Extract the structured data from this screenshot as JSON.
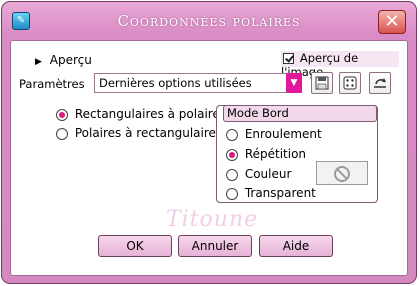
{
  "window": {
    "title": "Coordonnées polaires",
    "app_icon": "paint-app-icon",
    "close_icon": "close-icon",
    "close_glyph": "✕"
  },
  "preview": {
    "apercu_label": "Aperçu",
    "apercu_image_label": "Aperçu de l'image",
    "apercu_image_checked": true
  },
  "presets": {
    "label": "Paramètres",
    "selected": "Dernières options utilisées",
    "buttons": [
      "save-preset-icon",
      "randomize-icon",
      "reset-icon"
    ]
  },
  "conversion": {
    "options": [
      {
        "label": "Rectangulaires à polaires",
        "selected": true
      },
      {
        "label": "Polaires à rectangulaires",
        "selected": false
      }
    ]
  },
  "edge_mode": {
    "title": "Mode Bord",
    "options": [
      {
        "label": "Enroulement",
        "selected": false
      },
      {
        "label": "Répétition",
        "selected": true
      },
      {
        "label": "Couleur",
        "selected": false
      },
      {
        "label": "Transparent",
        "selected": false
      }
    ],
    "color_swatch_icon": "no-color-icon"
  },
  "watermark": "Titoune",
  "buttons": {
    "ok": "OK",
    "cancel": "Annuler",
    "help": "Aide"
  },
  "colors": {
    "frame": "#d98bc5",
    "accent": "#e0189a",
    "close": "#d9534f"
  }
}
